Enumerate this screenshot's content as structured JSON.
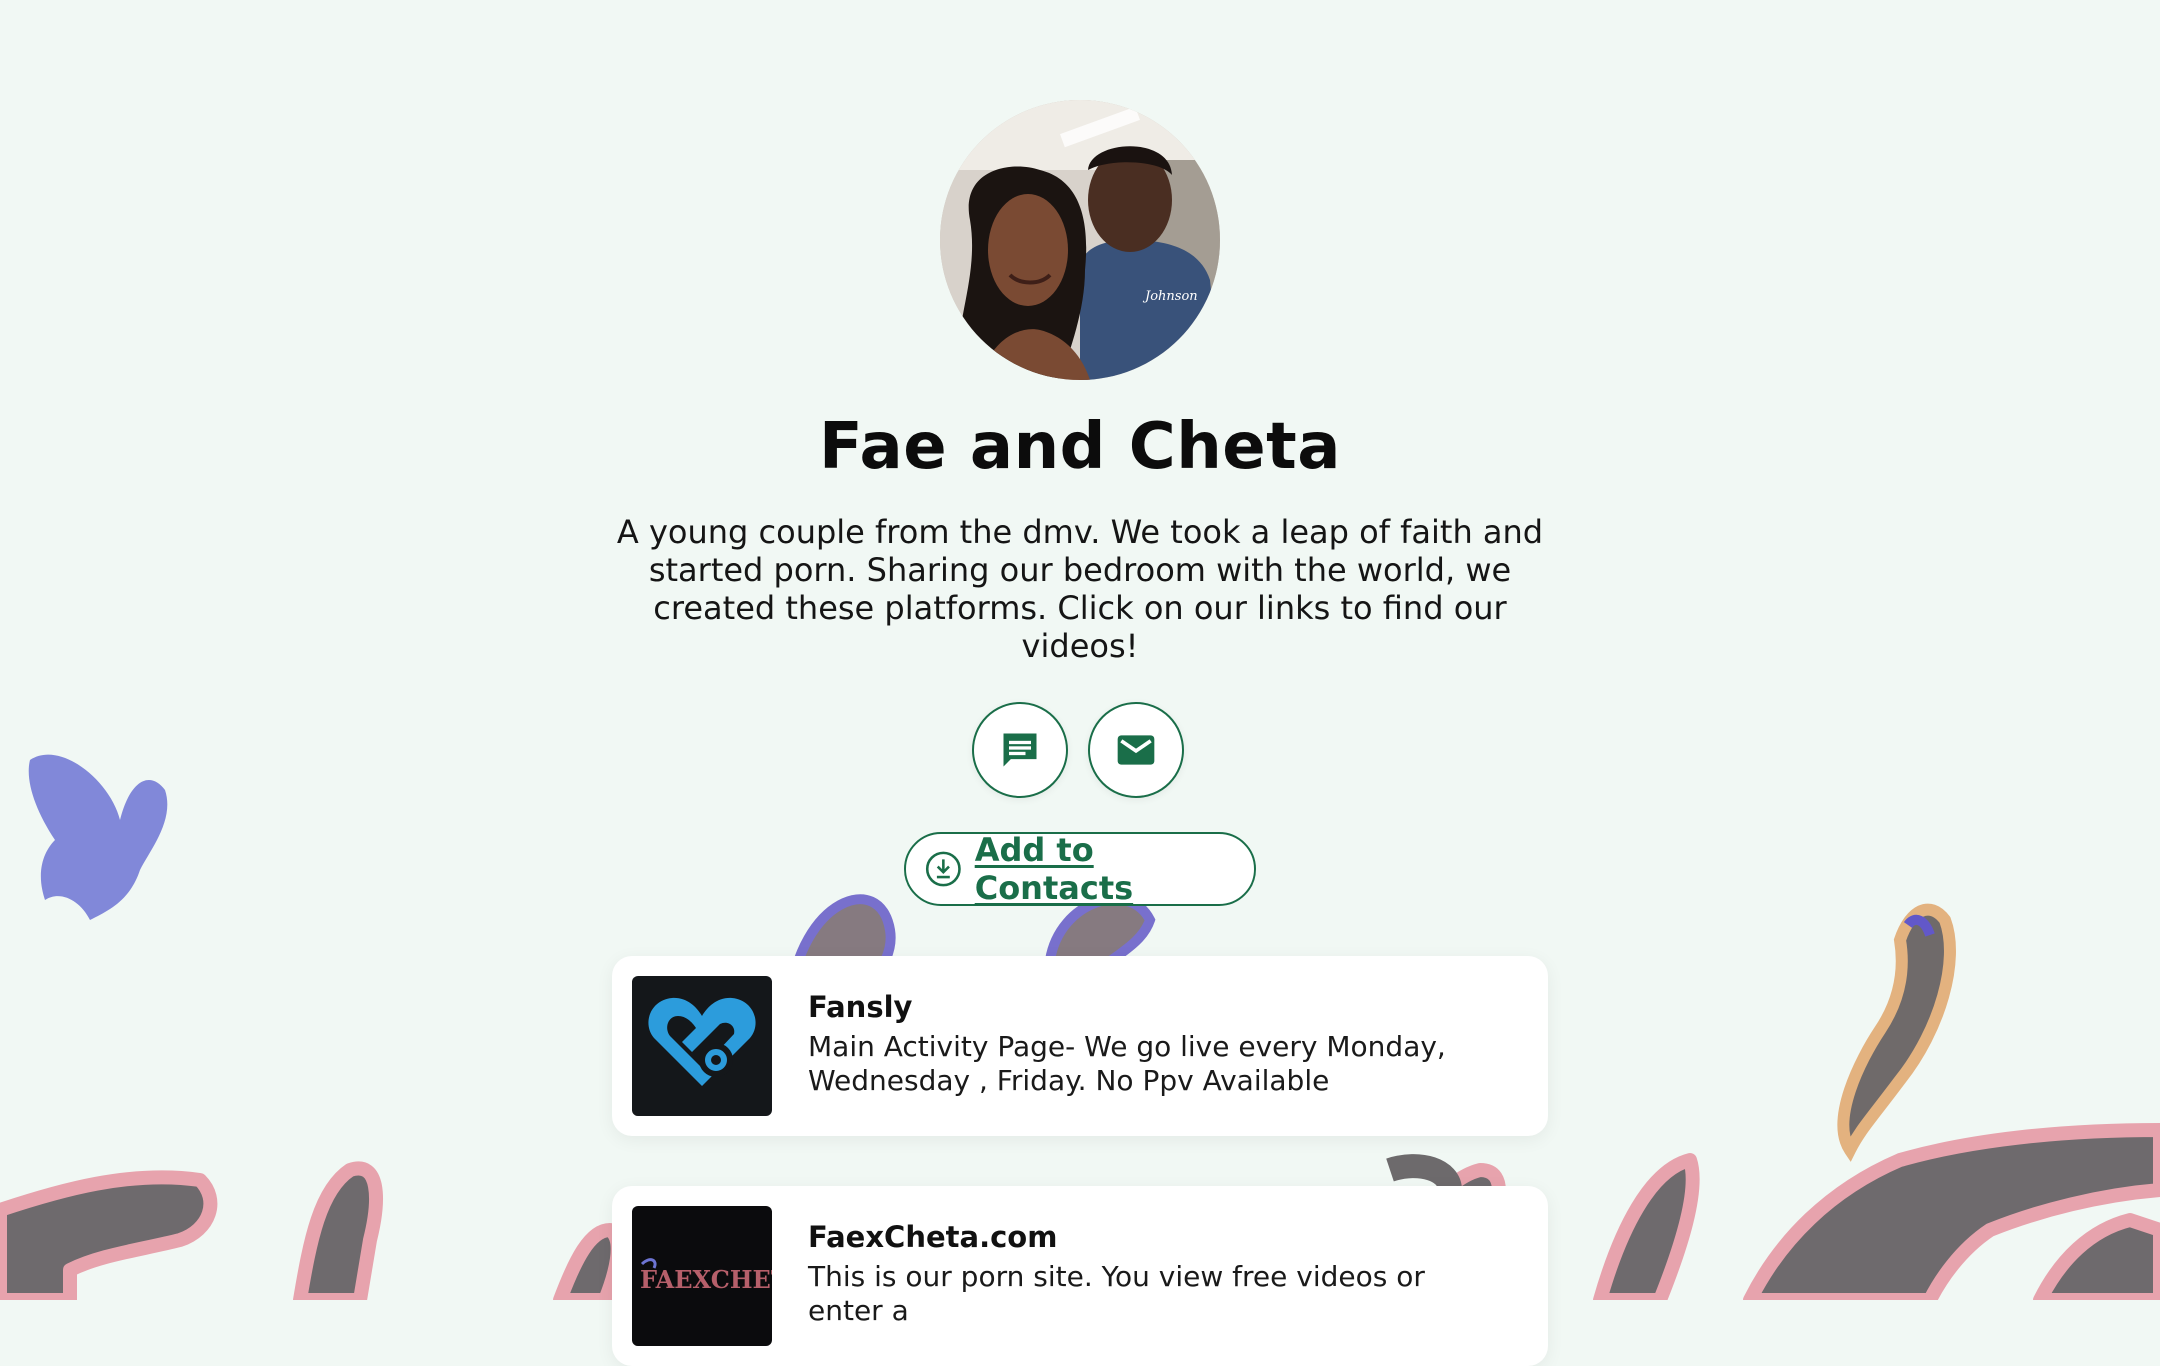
{
  "profile": {
    "name": "Fae and Cheta",
    "bio": "A young couple from the dmv. We took a leap of faith and started porn. Sharing our bedroom with the world, we created these platforms. Click on our links to find our videos!",
    "avatar_shirt_text": "Johnson"
  },
  "actions": {
    "sms_icon": "chat-bubble-icon",
    "email_icon": "envelope-icon",
    "add_contacts_label": "Add to Contacts",
    "add_contacts_icon": "download-circle-icon"
  },
  "links": [
    {
      "title": "Fansly",
      "description": "Main Activity Page- We go live every Monday, Wednesday , Friday. No Ppv Available",
      "icon": "fansly-heart-logo"
    },
    {
      "title": "FaexCheta.com",
      "description": "This is our porn site. You view free videos or enter a",
      "icon": "faexcheta-logo",
      "logo_text": "FAEXCHETA"
    }
  ],
  "theme": {
    "background": "#f1f8f4",
    "accent": "#1a6e49"
  }
}
